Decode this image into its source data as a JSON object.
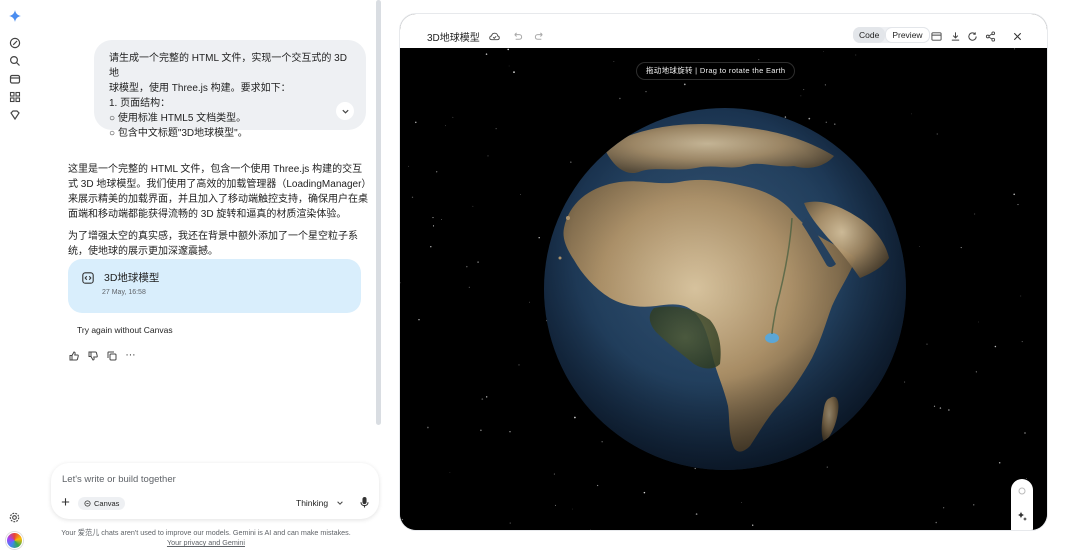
{
  "chat": {
    "user_message": {
      "lines": [
        "请生成一个完整的 HTML 文件，实现一个交互式的 3D 地",
        "球模型，使用 Three.js 构建。要求如下：",
        "1. 页面结构：",
        "○ 使用标准 HTML5 文档类型。",
        "○ 包含中文标题\"3D地球模型\"。"
      ]
    },
    "reply": {
      "paragraph1": "这里是一个完整的 HTML 文件，包含一个使用 Three.js 构建的交互式 3D 地球模型。我们使用了高效的加载管理器（LoadingManager）来展示精美的加载界面，并且加入了移动端触控支持，确保用户在桌面端和移动端都能获得流畅的 3D 旋转和逼真的材质渲染体验。",
      "paragraph2": "为了增强太空的真实感，我还在背景中额外添加了一个星空粒子系统，使地球的展示更加深邃震撼。"
    },
    "canvas_card": {
      "title": "3D地球模型",
      "date": "27 May, 16:58"
    },
    "try_again_label": "Try again without Canvas"
  },
  "input": {
    "placeholder": "Let's write or build together",
    "chip_label": "Canvas",
    "mode_label": "Thinking"
  },
  "disclaimer": {
    "text": "Your 爱范儿 chats aren't used to improve our models. Gemini is AI and can make mistakes.",
    "link": "Your privacy and Gemini"
  },
  "panel": {
    "title": "3D地球模型",
    "code_tab": "Code",
    "preview_tab": "Preview",
    "hint": "拖动地球旋转 | Drag to rotate the Earth"
  },
  "colors": {
    "user_bubble": "#eef0f3",
    "canvas_card": "#d9eefc",
    "viewport_bg": "#000000",
    "ocean": "#213e5c",
    "land": "#b59a72"
  }
}
